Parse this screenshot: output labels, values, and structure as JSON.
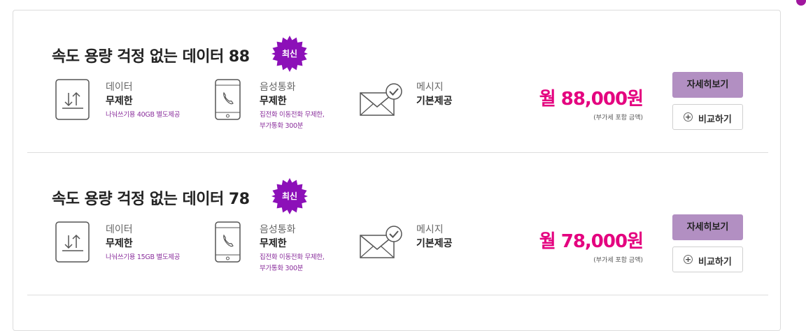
{
  "plans": [
    {
      "title": "속도 용량 걱정 없는 데이터 88",
      "badge": "최신",
      "data_label": "데이터",
      "data_value": "무제한",
      "data_note": "나눠쓰기용 40GB 별도제공",
      "voice_label": "음성통화",
      "voice_value": "무제한",
      "voice_note_1": "집전화 이동전화 무제한,",
      "voice_note_2": "부가통화 300분",
      "sms_label": "메시지",
      "sms_value": "기본제공",
      "price": "월 88,000원",
      "vat": "(부가세 포함 금액)",
      "detail_button": "자세히보기",
      "compare_button": "비교하기"
    },
    {
      "title": "속도 용량 걱정 없는 데이터 78",
      "badge": "최신",
      "data_label": "데이터",
      "data_value": "무제한",
      "data_note": "나눠쓰기용 15GB 별도제공",
      "voice_label": "음성통화",
      "voice_value": "무제한",
      "voice_note_1": "집전화 이동전화 무제한,",
      "voice_note_2": "부가통화 300분",
      "sms_label": "메시지",
      "sms_value": "기본제공",
      "price": "월 78,000원",
      "vat": "(부가세 포함 금액)",
      "detail_button": "자세히보기",
      "compare_button": "비교하기"
    }
  ],
  "icons": {
    "data": "data-transfer-icon",
    "voice": "phone-icon",
    "sms": "envelope-check-icon",
    "compare": "plus-circle-icon"
  },
  "colors": {
    "price": "#e4007f",
    "badge": "#8c10b8",
    "note": "#8a2e9c",
    "detail_button_bg": "#b28fc2"
  }
}
